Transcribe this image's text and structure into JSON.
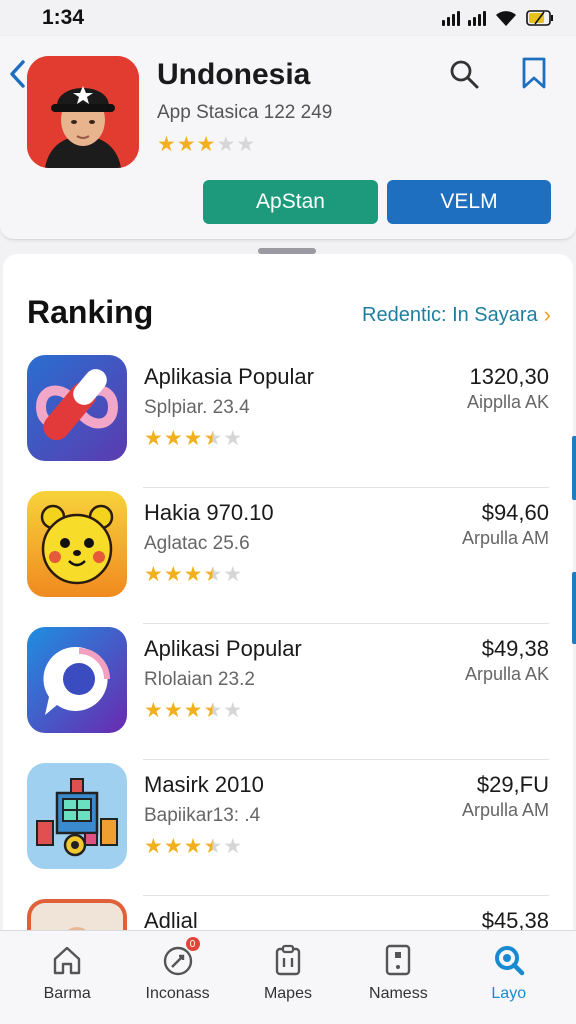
{
  "status_bar": {
    "time": "1:34"
  },
  "header": {
    "title": "Undonesia",
    "subtitle": "App Stasica 122 249",
    "rating": 3,
    "buttons": {
      "primary": "ApStan",
      "secondary": "VELM"
    },
    "colors": {
      "primary_button": "#1d9a7c",
      "secondary_button": "#1f6fc0"
    }
  },
  "ranking": {
    "title": "Ranking",
    "link": "Redentic: In Sayara",
    "items": [
      {
        "name": "Aplikasia Popular",
        "subtitle": "Splpiar. 23.4",
        "price": "1320,30",
        "seller": "Aipplla AK",
        "rating": 3.5,
        "icon": "infinity-app-icon"
      },
      {
        "name": "Hakia 970.10",
        "subtitle": "Aglatac 25.6",
        "price": "$94,60",
        "seller": "Arpulla AM",
        "rating": 3.5,
        "icon": "bear-app-icon"
      },
      {
        "name": "Aplikasi Popular",
        "subtitle": "Rlolaian 23.2",
        "price": "$49,38",
        "seller": "Arpulla AK",
        "rating": 3.5,
        "icon": "chat-bubble-app-icon"
      },
      {
        "name": "Masirk 2010",
        "subtitle": "Bapiikar13: .4",
        "price": "$29,FU",
        "seller": "Arpulla AM",
        "rating": 3.5,
        "icon": "city-robot-app-icon"
      },
      {
        "name": "Adlial",
        "subtitle": "",
        "price": "$45,38",
        "seller": "",
        "rating": 0,
        "icon": "portrait-app-icon"
      }
    ]
  },
  "tab_bar": {
    "tabs": [
      {
        "label": "Barma",
        "icon": "home-icon"
      },
      {
        "label": "Inconass",
        "icon": "rocket-icon",
        "badge": "0"
      },
      {
        "label": "Mapes",
        "icon": "clipboard-icon"
      },
      {
        "label": "Namess",
        "icon": "device-icon"
      },
      {
        "label": "Layo",
        "icon": "search-icon",
        "active": true
      }
    ]
  }
}
